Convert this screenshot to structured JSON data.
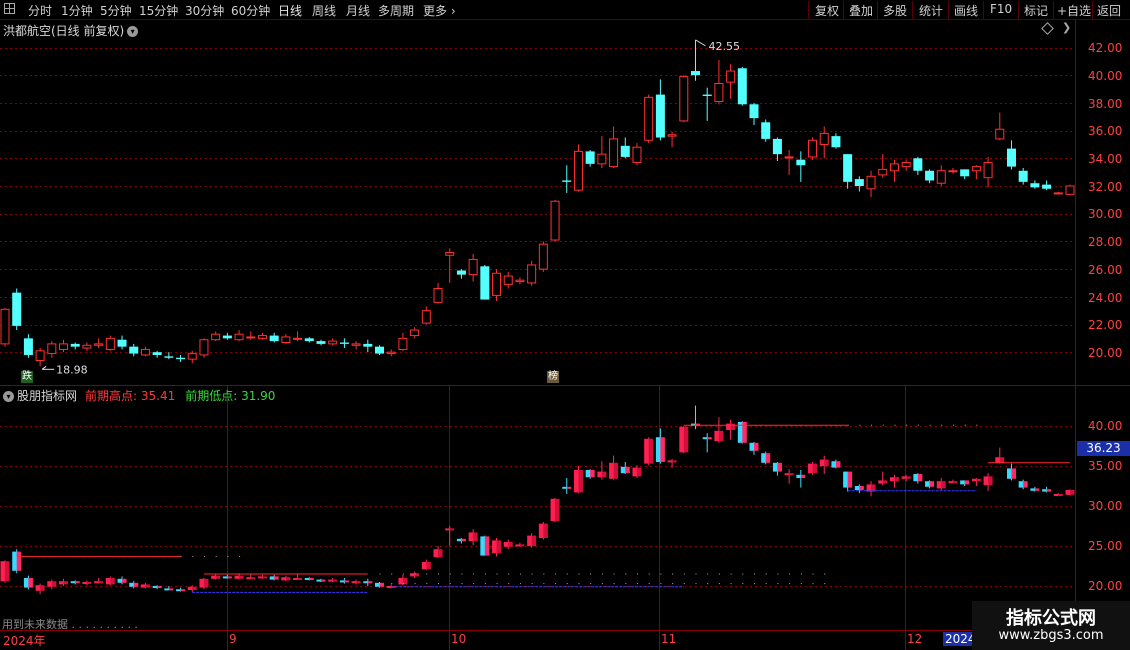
{
  "toolbar": {
    "tabs": [
      "分时",
      "1分钟",
      "5分钟",
      "15分钟",
      "30分钟",
      "60分钟",
      "日线",
      "周线",
      "月线",
      "多周期",
      "更多"
    ],
    "active_tab": "日线",
    "right_buttons": [
      "复权",
      "叠加",
      "多股",
      "统计",
      "画线",
      "F10",
      "标记",
      "+自选",
      "返回"
    ]
  },
  "main_panel": {
    "title": "洪都航空(日线 前复权)",
    "high_label": "42.55",
    "low_label": "18.98",
    "badge_down": "跌",
    "badge_list": "榜",
    "y_ticks": [
      "42.00",
      "40.00",
      "38.00",
      "36.00",
      "34.00",
      "32.00",
      "30.00",
      "28.00",
      "26.00",
      "24.00",
      "22.00",
      "20.00"
    ]
  },
  "indicator_panel": {
    "name": "股朋指标网",
    "prev_high_label": "前期高点: 35.41",
    "prev_low_label": "前期低点: 31.90",
    "y_ticks": [
      "40.00",
      "35.00",
      "30.00",
      "25.00",
      "20.00"
    ],
    "current_value": "36.23",
    "future_note": "用到未来数据"
  },
  "x_axis": {
    "labels": [
      "2024年",
      "9",
      "10",
      "11",
      "12",
      "2024"
    ]
  },
  "watermark": {
    "line1": "指标公式网",
    "line2": "www.zbgs3.com"
  },
  "colors": {
    "up": "#ff3030",
    "down": "#54ffff",
    "grid": "#8a0000",
    "axis_text": "#ff4040"
  },
  "chart_data": {
    "type": "candlestick",
    "price_range": [
      18.2,
      43.2
    ],
    "candles": [
      {
        "o": 20.6,
        "h": 23.2,
        "l": 20.4,
        "c": 23.1
      },
      {
        "o": 24.3,
        "h": 24.6,
        "l": 21.6,
        "c": 21.9
      },
      {
        "o": 21.0,
        "h": 21.3,
        "l": 19.6,
        "c": 19.8
      },
      {
        "o": 19.4,
        "h": 20.3,
        "l": 18.98,
        "c": 20.1
      },
      {
        "o": 19.9,
        "h": 20.8,
        "l": 19.6,
        "c": 20.6
      },
      {
        "o": 20.2,
        "h": 20.9,
        "l": 20.0,
        "c": 20.6
      },
      {
        "o": 20.6,
        "h": 20.7,
        "l": 20.2,
        "c": 20.4
      },
      {
        "o": 20.3,
        "h": 20.7,
        "l": 20.1,
        "c": 20.5
      },
      {
        "o": 20.5,
        "h": 21.0,
        "l": 20.3,
        "c": 20.6
      },
      {
        "o": 20.2,
        "h": 21.2,
        "l": 20.1,
        "c": 21.0
      },
      {
        "o": 20.9,
        "h": 21.2,
        "l": 20.2,
        "c": 20.4
      },
      {
        "o": 20.4,
        "h": 20.6,
        "l": 19.7,
        "c": 19.9
      },
      {
        "o": 19.8,
        "h": 20.4,
        "l": 19.7,
        "c": 20.2
      },
      {
        "o": 20.0,
        "h": 20.1,
        "l": 19.6,
        "c": 19.8
      },
      {
        "o": 19.7,
        "h": 20.0,
        "l": 19.5,
        "c": 19.6
      },
      {
        "o": 19.6,
        "h": 19.8,
        "l": 19.3,
        "c": 19.5
      },
      {
        "o": 19.5,
        "h": 20.1,
        "l": 19.2,
        "c": 19.9
      },
      {
        "o": 19.8,
        "h": 21.0,
        "l": 19.6,
        "c": 20.9
      },
      {
        "o": 20.9,
        "h": 21.5,
        "l": 20.8,
        "c": 21.3
      },
      {
        "o": 21.2,
        "h": 21.4,
        "l": 20.9,
        "c": 21.0
      },
      {
        "o": 20.9,
        "h": 21.6,
        "l": 20.8,
        "c": 21.3
      },
      {
        "o": 21.1,
        "h": 21.5,
        "l": 20.9,
        "c": 21.1
      },
      {
        "o": 21.0,
        "h": 21.4,
        "l": 20.9,
        "c": 21.2
      },
      {
        "o": 21.2,
        "h": 21.4,
        "l": 20.7,
        "c": 20.8
      },
      {
        "o": 20.7,
        "h": 21.3,
        "l": 20.6,
        "c": 21.1
      },
      {
        "o": 21.0,
        "h": 21.5,
        "l": 20.8,
        "c": 21.0
      },
      {
        "o": 21.0,
        "h": 21.1,
        "l": 20.7,
        "c": 20.8
      },
      {
        "o": 20.8,
        "h": 20.9,
        "l": 20.5,
        "c": 20.6
      },
      {
        "o": 20.6,
        "h": 21.0,
        "l": 20.5,
        "c": 20.8
      },
      {
        "o": 20.7,
        "h": 21.0,
        "l": 20.3,
        "c": 20.6
      },
      {
        "o": 20.5,
        "h": 20.8,
        "l": 20.2,
        "c": 20.6
      },
      {
        "o": 20.6,
        "h": 20.9,
        "l": 20.0,
        "c": 20.4
      },
      {
        "o": 20.4,
        "h": 20.5,
        "l": 19.8,
        "c": 19.9
      },
      {
        "o": 19.9,
        "h": 20.2,
        "l": 19.7,
        "c": 20.0
      },
      {
        "o": 20.2,
        "h": 21.4,
        "l": 20.1,
        "c": 21.0
      },
      {
        "o": 21.2,
        "h": 21.8,
        "l": 21.0,
        "c": 21.6
      },
      {
        "o": 22.1,
        "h": 23.3,
        "l": 22.0,
        "c": 23.0
      },
      {
        "o": 23.6,
        "h": 25.0,
        "l": 23.5,
        "c": 24.6
      },
      {
        "o": 27.0,
        "h": 27.5,
        "l": 25.0,
        "c": 27.2
      },
      {
        "o": 25.9,
        "h": 26.0,
        "l": 25.3,
        "c": 25.6
      },
      {
        "o": 25.6,
        "h": 27.1,
        "l": 25.1,
        "c": 26.7
      },
      {
        "o": 26.2,
        "h": 26.3,
        "l": 23.8,
        "c": 23.8
      },
      {
        "o": 24.1,
        "h": 26.0,
        "l": 23.7,
        "c": 25.7
      },
      {
        "o": 24.9,
        "h": 25.8,
        "l": 24.6,
        "c": 25.5
      },
      {
        "o": 25.1,
        "h": 25.4,
        "l": 24.9,
        "c": 25.2
      },
      {
        "o": 25.0,
        "h": 26.6,
        "l": 24.8,
        "c": 26.3
      },
      {
        "o": 26.0,
        "h": 28.0,
        "l": 25.8,
        "c": 27.8
      },
      {
        "o": 28.1,
        "h": 31.0,
        "l": 28.0,
        "c": 30.9
      },
      {
        "o": 32.4,
        "h": 33.5,
        "l": 31.5,
        "c": 32.3
      },
      {
        "o": 31.7,
        "h": 35.0,
        "l": 31.6,
        "c": 34.5
      },
      {
        "o": 34.5,
        "h": 34.6,
        "l": 33.4,
        "c": 33.6
      },
      {
        "o": 33.6,
        "h": 35.6,
        "l": 33.3,
        "c": 34.3
      },
      {
        "o": 33.4,
        "h": 36.3,
        "l": 33.3,
        "c": 35.4
      },
      {
        "o": 34.9,
        "h": 35.5,
        "l": 34.0,
        "c": 34.1
      },
      {
        "o": 33.7,
        "h": 35.1,
        "l": 33.5,
        "c": 34.8
      },
      {
        "o": 35.3,
        "h": 38.6,
        "l": 35.1,
        "c": 38.4
      },
      {
        "o": 38.6,
        "h": 39.7,
        "l": 35.3,
        "c": 35.5
      },
      {
        "o": 35.6,
        "h": 35.9,
        "l": 34.8,
        "c": 35.7
      },
      {
        "o": 36.7,
        "h": 40.0,
        "l": 36.6,
        "c": 39.9
      },
      {
        "o": 40.3,
        "h": 42.55,
        "l": 39.6,
        "c": 40.0
      },
      {
        "o": 38.6,
        "h": 39.1,
        "l": 36.7,
        "c": 38.5
      },
      {
        "o": 38.1,
        "h": 41.1,
        "l": 37.9,
        "c": 39.4
      },
      {
        "o": 39.5,
        "h": 40.8,
        "l": 38.3,
        "c": 40.3
      },
      {
        "o": 40.5,
        "h": 40.6,
        "l": 37.8,
        "c": 37.9
      },
      {
        "o": 37.9,
        "h": 38.0,
        "l": 36.4,
        "c": 36.9
      },
      {
        "o": 36.6,
        "h": 36.8,
        "l": 35.2,
        "c": 35.4
      },
      {
        "o": 35.4,
        "h": 35.5,
        "l": 33.8,
        "c": 34.3
      },
      {
        "o": 34.1,
        "h": 34.6,
        "l": 32.8,
        "c": 34.1
      },
      {
        "o": 33.9,
        "h": 34.5,
        "l": 32.3,
        "c": 33.5
      },
      {
        "o": 34.1,
        "h": 35.5,
        "l": 33.9,
        "c": 35.3
      },
      {
        "o": 35.0,
        "h": 36.3,
        "l": 34.0,
        "c": 35.8
      },
      {
        "o": 35.6,
        "h": 35.8,
        "l": 34.7,
        "c": 34.8
      },
      {
        "o": 34.3,
        "h": 34.3,
        "l": 31.8,
        "c": 32.3
      },
      {
        "o": 32.5,
        "h": 32.7,
        "l": 31.6,
        "c": 32.0
      },
      {
        "o": 31.8,
        "h": 33.1,
        "l": 31.2,
        "c": 32.7
      },
      {
        "o": 32.8,
        "h": 34.3,
        "l": 32.6,
        "c": 33.2
      },
      {
        "o": 33.1,
        "h": 33.9,
        "l": 32.3,
        "c": 33.6
      },
      {
        "o": 33.4,
        "h": 33.9,
        "l": 33.1,
        "c": 33.7
      },
      {
        "o": 34.0,
        "h": 34.1,
        "l": 32.8,
        "c": 33.1
      },
      {
        "o": 33.1,
        "h": 33.2,
        "l": 32.2,
        "c": 32.4
      },
      {
        "o": 32.2,
        "h": 33.5,
        "l": 32.0,
        "c": 33.1
      },
      {
        "o": 33.1,
        "h": 33.3,
        "l": 32.9,
        "c": 33.1
      },
      {
        "o": 33.2,
        "h": 33.2,
        "l": 32.5,
        "c": 32.7
      },
      {
        "o": 33.1,
        "h": 33.5,
        "l": 32.5,
        "c": 33.4
      },
      {
        "o": 32.6,
        "h": 34.1,
        "l": 31.9,
        "c": 33.7
      },
      {
        "o": 35.4,
        "h": 37.3,
        "l": 35.3,
        "c": 36.1
      },
      {
        "o": 34.7,
        "h": 35.3,
        "l": 33.2,
        "c": 33.4
      },
      {
        "o": 33.1,
        "h": 33.3,
        "l": 32.1,
        "c": 32.3
      },
      {
        "o": 32.2,
        "h": 32.4,
        "l": 31.8,
        "c": 31.9
      },
      {
        "o": 32.1,
        "h": 32.4,
        "l": 31.7,
        "c": 31.8
      },
      {
        "o": 31.5,
        "h": 31.6,
        "l": 31.4,
        "c": 31.5
      },
      {
        "o": 31.4,
        "h": 32.1,
        "l": 31.3,
        "c": 32.0
      }
    ],
    "indicator": {
      "prev_high_lines": [
        {
          "from": 1,
          "to": 15,
          "value": 23.7
        },
        {
          "from": 17,
          "to": 31,
          "value": 21.5
        },
        {
          "from": 58,
          "to": 72,
          "value": 40.1
        },
        {
          "from": 84,
          "to": 91,
          "value": 35.41
        }
      ],
      "prev_low_lines": [
        {
          "from": 16,
          "to": 31,
          "value": 19.2
        },
        {
          "from": 33,
          "to": 58,
          "value": 19.9
        },
        {
          "from": 72,
          "to": 83,
          "value": 31.9
        }
      ]
    }
  }
}
